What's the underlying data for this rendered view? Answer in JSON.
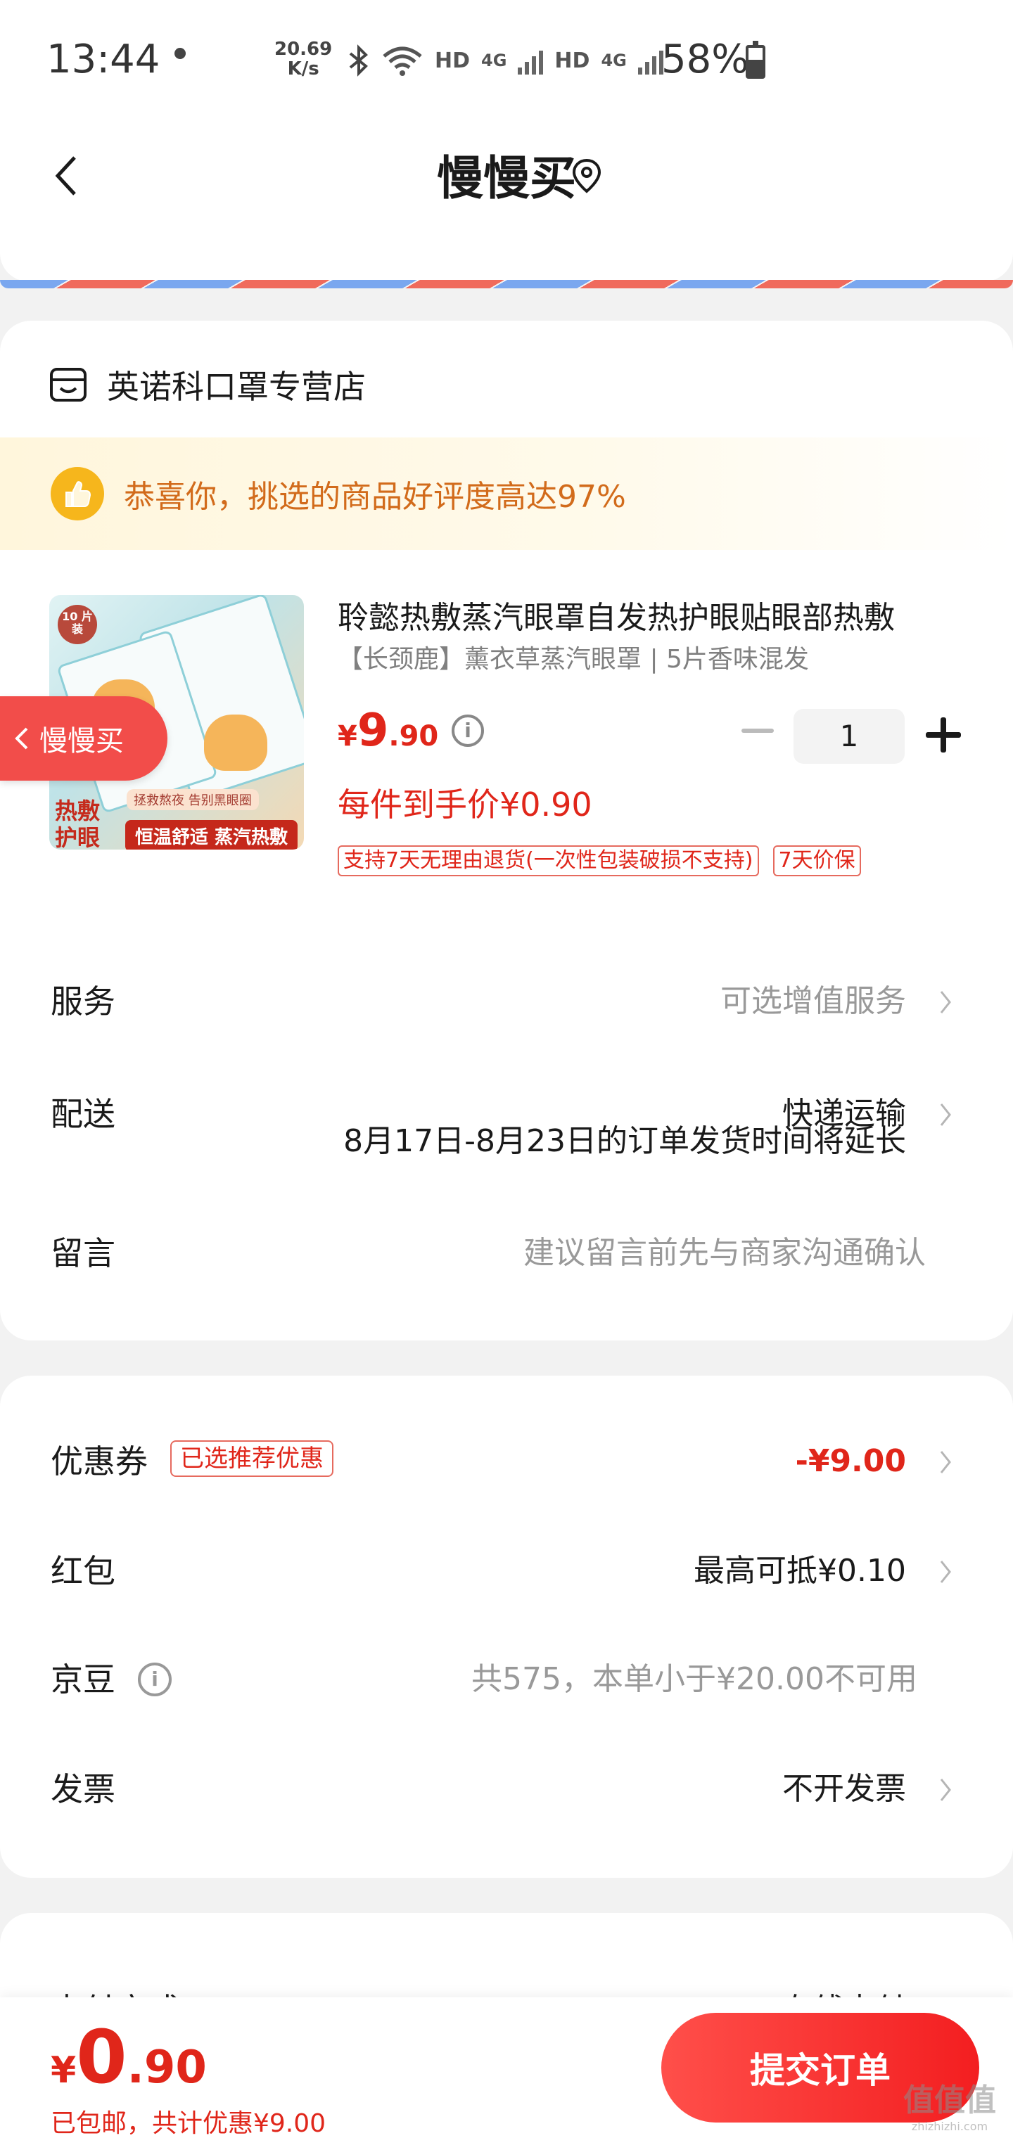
{
  "status_bar": {
    "time": "13:44",
    "net_speed": "20.69",
    "net_speed_unit": "K/s",
    "hd1": "HD",
    "hd2": "HD",
    "net1": "4G",
    "net2": "4G",
    "battery": "58%",
    "battery_level": 0.58
  },
  "header": {
    "title": "慢慢买"
  },
  "store": {
    "name": "英诺科口罩专营店"
  },
  "praise": {
    "text": "恭喜你，挑选的商品好评度高达97%"
  },
  "floating_tag": {
    "label": "慢慢买"
  },
  "product": {
    "title": "聆懿热敷蒸汽眼罩自发热护眼贴眼部热敷",
    "spec": "【长颈鹿】薰衣草蒸汽眼罩 | 5片香味混发",
    "price_symbol": "¥",
    "price_int": "9",
    "price_dec": ".90",
    "quantity": "1",
    "unit_price": "每件到手价¥0.90",
    "tags": [
      "支持7天无理由退货(一次性包装破损不支持)",
      "7天价保"
    ],
    "image_badge": "10\n片装",
    "image_caption_top": "拯救熬夜 告别黑眼圈",
    "image_caption_left": "热敷护眼",
    "image_caption_bottom": "恒温舒适 蒸汽热敷"
  },
  "order_rows": {
    "service_label": "服务",
    "service_value": "可选增值服务",
    "delivery_label": "配送",
    "delivery_value": "快递运输",
    "delivery_note": "8月17日-8月23日的订单发货时间将延长",
    "message_label": "留言",
    "message_placeholder": "建议留言前先与商家沟通确认"
  },
  "discount_rows": {
    "coupon_label": "优惠券",
    "coupon_badge": "已选推荐优惠",
    "coupon_value": "-¥9.00",
    "redpacket_label": "红包",
    "redpacket_value": "最高可抵¥0.10",
    "beans_label": "京豆",
    "beans_value": "共575，本单小于¥20.00不可用",
    "invoice_label": "发票",
    "invoice_value": "不开发票"
  },
  "payment": {
    "label": "支付方式",
    "value": "在线支付"
  },
  "bottom": {
    "total_symbol": "¥",
    "total_int": "0",
    "total_dec": ".90",
    "note": "已包邮，共计优惠¥9.00",
    "submit_label": "提交订单"
  },
  "watermark": {
    "text": "值值值",
    "sub": "zhizhizhi.com"
  },
  "colors": {
    "accent": "#e0261a",
    "button": "#f31e20"
  }
}
